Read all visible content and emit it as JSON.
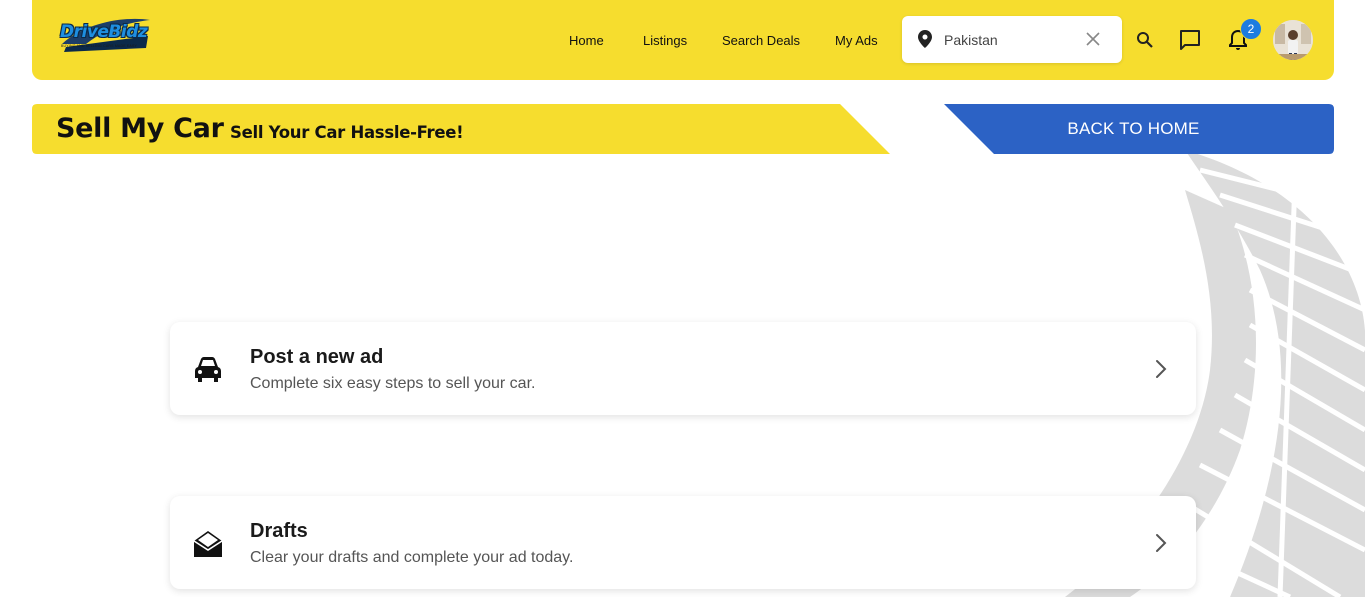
{
  "brand": {
    "logo_text": "DriveBidz",
    "tagline": "BUYING AND SELLING CARS MADE EASY"
  },
  "nav": {
    "items": [
      {
        "label": "Home"
      },
      {
        "label": "Listings"
      },
      {
        "label": "Search Deals"
      },
      {
        "label": "My Ads"
      }
    ]
  },
  "location": {
    "value": "Pakistan",
    "icon": "location-pin-icon"
  },
  "header_icons": {
    "search": "search-icon",
    "chat": "chat-icon",
    "notifications": "bell-icon",
    "notification_count": "2"
  },
  "banner": {
    "title": "Sell My Car",
    "subtitle": "Sell Your Car Hassle-Free!",
    "back_button_label": "BACK TO HOME"
  },
  "options": [
    {
      "title": "Post a new ad",
      "description": "Complete six easy steps to sell your car.",
      "icon": "car-icon"
    },
    {
      "title": "Drafts",
      "description": "Clear your drafts and complete your ad today.",
      "icon": "envelope-open-icon"
    }
  ],
  "colors": {
    "brand_yellow": "#f6dd2e",
    "accent_blue": "#2c62c5",
    "badge_blue": "#1d7ce0"
  }
}
